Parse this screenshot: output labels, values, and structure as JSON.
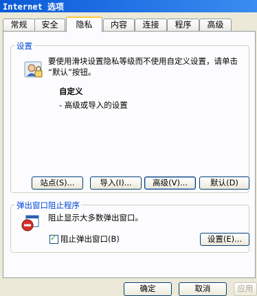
{
  "window": {
    "title": "Internet 选项"
  },
  "tabs": [
    {
      "label": "常规"
    },
    {
      "label": "安全"
    },
    {
      "label": "隐私"
    },
    {
      "label": "内容"
    },
    {
      "label": "连接"
    },
    {
      "label": "程序"
    },
    {
      "label": "高级"
    }
  ],
  "active_tab": "隐私",
  "settings": {
    "group_label": "设置",
    "desc_line1": "要使用滑块设置隐私等级而不使用自定义设置，请单击",
    "desc_line2": "“默认”按钮。",
    "level_title": "自定义",
    "level_desc": "- 高级或导入的设置",
    "buttons": {
      "sites": "站点(S)...",
      "import": "导入(I)...",
      "advanced": "高级(V)...",
      "default": "默认(D)"
    }
  },
  "popup": {
    "group_label": "弹出窗口阻止程序",
    "desc": "阻止显示大多数弹出窗口。",
    "checkbox_label": "阻止弹出窗口(B)",
    "checkbox_checked": true,
    "settings_button": "设置(E)..."
  },
  "footer": {
    "ok": "确定",
    "cancel": "取消",
    "apply": "应用"
  },
  "icons": {
    "privacy": "privacy-user-icon",
    "popup_blocker": "popup-blocker-icon"
  }
}
